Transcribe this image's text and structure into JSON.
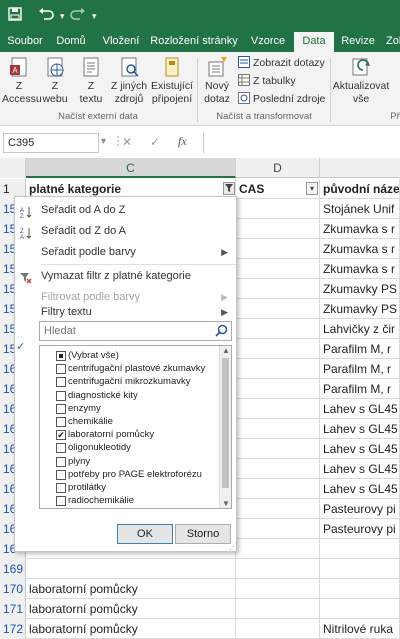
{
  "titlebar": {
    "save_icon": "save-icon",
    "undo_icon": "undo-icon",
    "redo_icon": "redo-icon"
  },
  "tabs": [
    {
      "label": "Soubor"
    },
    {
      "label": "Domů"
    },
    {
      "label": "Vložení"
    },
    {
      "label": "Rozložení stránky"
    },
    {
      "label": "Vzorce"
    },
    {
      "label": "Data",
      "active": true
    },
    {
      "label": "Revize"
    },
    {
      "label": "Zobr"
    }
  ],
  "ribbon": {
    "access": "Z\nAccessu",
    "web": "Z\nwebu",
    "text": "Z\ntextu",
    "other": "Z jiných\nzdrojů",
    "existing": "Existující\npřipojení",
    "new_query": "Nový\ndotaz",
    "show_queries": "Zobrazit dotazy",
    "from_table": "Z tabulky",
    "recent": "Poslední zdroje",
    "refresh": "Aktualizovat\nvše",
    "group_external": "Načíst externí data",
    "group_transform": "Načíst a transformovat",
    "group_last": "Př"
  },
  "formula": {
    "namebox": "C395",
    "cancel": "✕",
    "enter": "✓",
    "fx": "fx"
  },
  "columns": {
    "c": "C",
    "d": "D"
  },
  "sheet": {
    "header_row": {
      "rn": "1",
      "c": "platné kategorie",
      "d": "CAS",
      "e": "původní náze"
    },
    "rows": [
      {
        "rn": "15",
        "e": "Stojánek Unif"
      },
      {
        "rn": "15",
        "e": "Zkumavka s r"
      },
      {
        "rn": "15",
        "e": "Zkumavka s r"
      },
      {
        "rn": "15",
        "e": "Zkumavka s r"
      },
      {
        "rn": "15",
        "e": "Zkumavky PS"
      },
      {
        "rn": "15",
        "e": "Zkumavky PS"
      },
      {
        "rn": "15",
        "e": "Lahvičky z čir"
      },
      {
        "rn": "15",
        "e": "Parafilm M, r"
      },
      {
        "rn": "16",
        "e": "Parafilm M, r"
      },
      {
        "rn": "16",
        "e": "Parafilm M, r"
      },
      {
        "rn": "16",
        "e": "Lahev s GL45"
      },
      {
        "rn": "16",
        "e": "Lahev s GL45"
      },
      {
        "rn": "16",
        "e": "Lahev s GL45"
      },
      {
        "rn": "16",
        "e": "Lahev s GL45"
      },
      {
        "rn": "16",
        "e": "Lahev s GL45"
      },
      {
        "rn": "16",
        "e": "Pasteurovy pi"
      },
      {
        "rn": "16",
        "e": "Pasteurovy pi"
      },
      {
        "rn": "16",
        "e": ""
      },
      {
        "rn": "169",
        "e": ""
      },
      {
        "rn": "170",
        "c": "laboratorní pomůcky",
        "e": ""
      },
      {
        "rn": "171",
        "c": "laboratorní pomůcky",
        "e": ""
      },
      {
        "rn": "172",
        "c": "laboratorní pomůcky",
        "e": "Nitrilové ruka"
      }
    ]
  },
  "filter_menu": {
    "sort_az": "Seřadit od A do Z",
    "sort_za": "Seřadit od Z do A",
    "sort_color": "Seřadit podle barvy",
    "clear_filter": "Vymazat filtr z platné kategorie",
    "filter_color": "Filtrovat podle barvy",
    "text_filters": "Filtry textu",
    "search_placeholder": "Hledat",
    "items": [
      {
        "label": "(Vybrat vše)",
        "state": "partial"
      },
      {
        "label": "centrifugační plastové zkumavky",
        "state": "unchecked"
      },
      {
        "label": "centrifugační mikrozkumavky",
        "state": "unchecked"
      },
      {
        "label": "diagnostické kity",
        "state": "unchecked"
      },
      {
        "label": "enzymy",
        "state": "unchecked"
      },
      {
        "label": "chemikálie",
        "state": "unchecked"
      },
      {
        "label": "laboratorní pomůcky",
        "state": "checked"
      },
      {
        "label": "oligonukleotidy",
        "state": "unchecked"
      },
      {
        "label": "plyny",
        "state": "unchecked"
      },
      {
        "label": "potřeby pro PAGE elektroforézu",
        "state": "unchecked"
      },
      {
        "label": "protilátky",
        "state": "unchecked"
      },
      {
        "label": "radiochemikálie",
        "state": "unchecked"
      }
    ],
    "ok": "OK",
    "cancel": "Storno"
  },
  "colors": {
    "excel_green": "#217346",
    "row_number_blue": "#1b53ba"
  }
}
